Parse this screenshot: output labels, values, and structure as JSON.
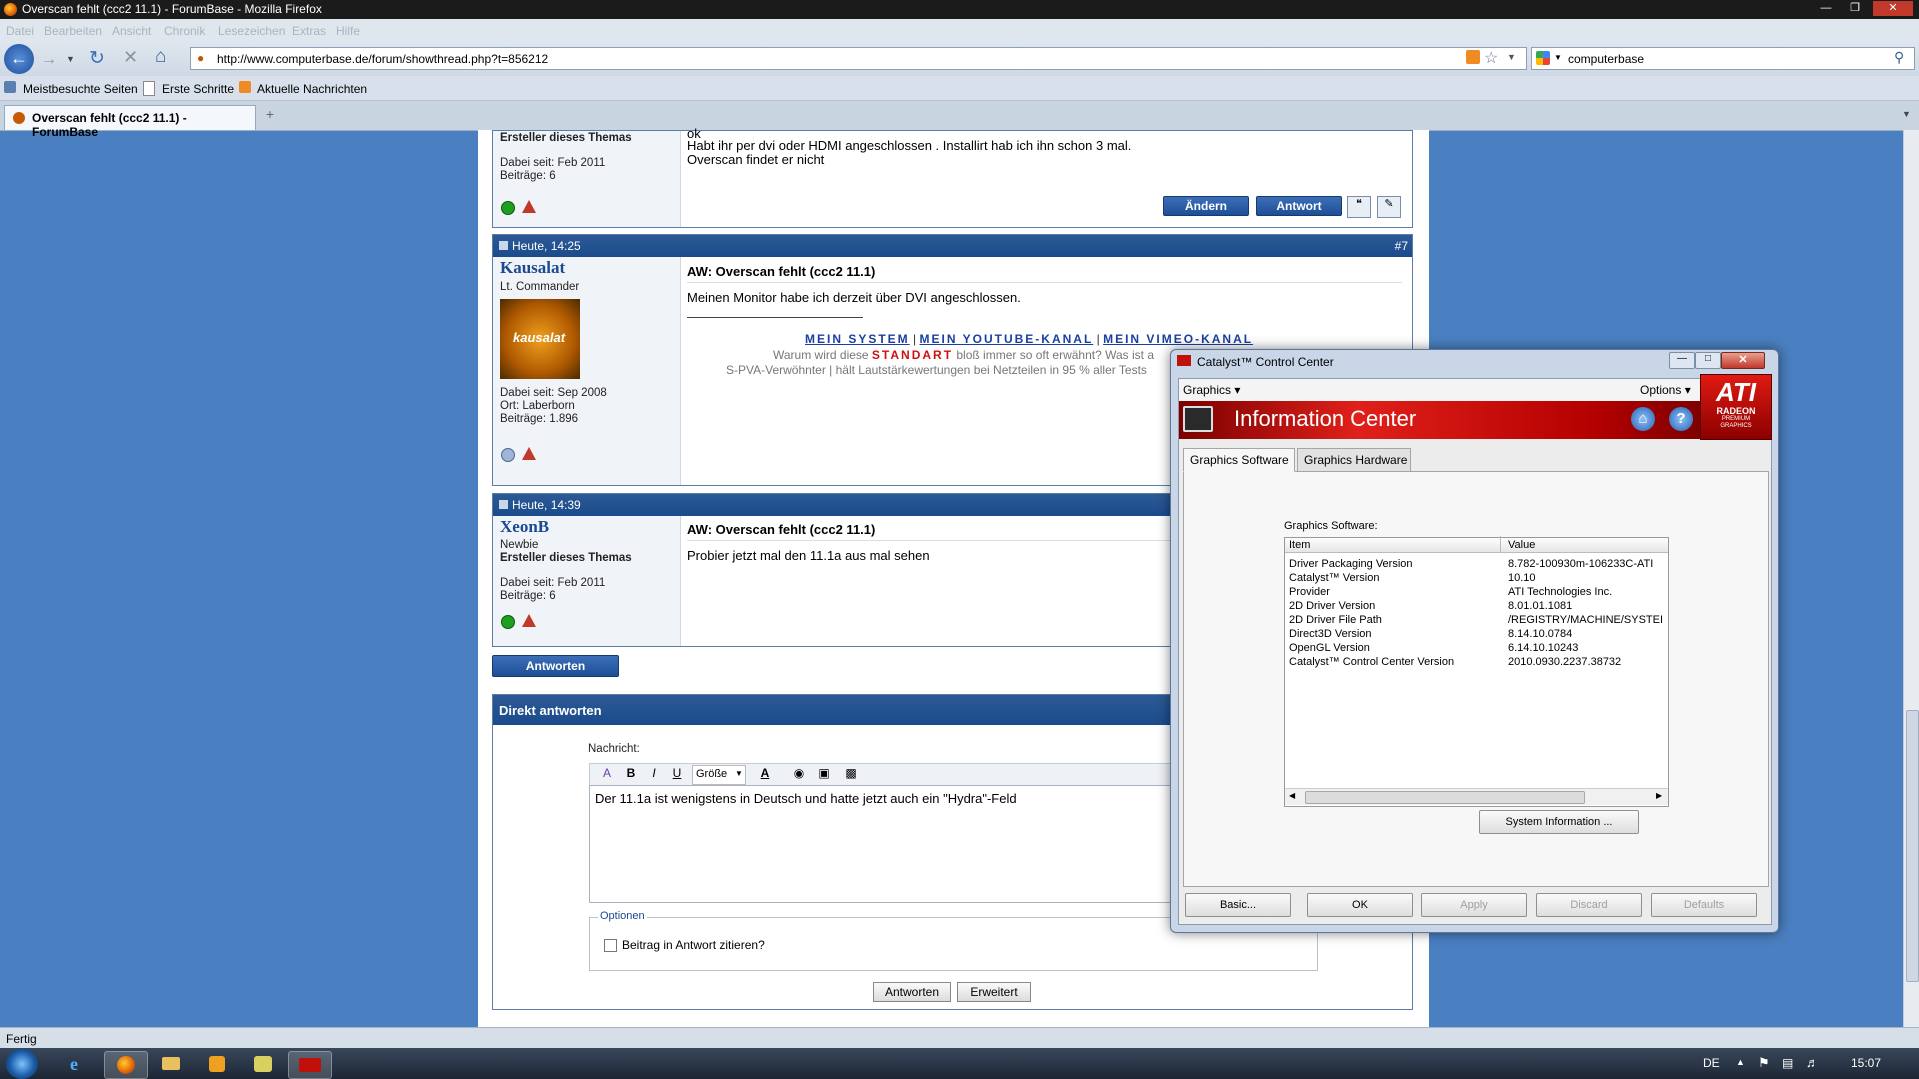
{
  "browser": {
    "window_title": "Overscan fehlt (ccc2 11.1) - ForumBase - Mozilla Firefox",
    "menu": [
      "Datei",
      "Bearbeiten",
      "Ansicht",
      "Chronik",
      "Lesezeichen",
      "Extras",
      "Hilfe"
    ],
    "url": "http://www.computerbase.de/forum/showthread.php?t=856212",
    "search_value": "computerbase",
    "bookmarks": [
      "Meistbesuchte Seiten",
      "Erste Schritte",
      "Aktuelle Nachrichten"
    ],
    "tab_title": "Overscan fehlt (ccc2 11.1) - ForumBase",
    "new_tab_symbol": "+",
    "status": "Fertig"
  },
  "post_top": {
    "user_role": "Ersteller dieses Themas",
    "joined": "Dabei seit: Feb 2011",
    "posts": "Beiträge: 6",
    "line0": "ok",
    "line1": "Habt ihr per dvi oder HDMI angeschlossen . Installirt hab ich ihn schon 3 mal.",
    "line2": "Overscan findet er nicht",
    "edit_label": "Ändern",
    "reply_label": "Antwort"
  },
  "post7": {
    "time": "Heute, 14:25",
    "number": "#7",
    "username": "Kausalat",
    "rank": "Lt. Commander",
    "avatar_text": "kausalat",
    "joined": "Dabei seit: Sep 2008",
    "location": "Ort: Laberborn",
    "posts": "Beiträge: 1.896",
    "subject": "AW: Overscan fehlt (ccc2 11.1)",
    "body": "Meinen Monitor habe ich derzeit über DVI angeschlossen.",
    "sig_link1": "MEIN SYSTEM",
    "sig_link2": "MEIN YOUTUBE-KANAL",
    "sig_link3": "MEIN VIMEO-KANAL",
    "sig_sep": "|",
    "sig_line2_pre": "Warum wird diese",
    "sig_line2_red": "STANDART",
    "sig_line2_post": "bloß immer so oft erwähnt? Was ist a",
    "sig_line3": "S-PVA-Verwöhnter  |  hält Lautstärkewertungen bei Netzteilen in 95 % aller Tests"
  },
  "post8": {
    "time": "Heute, 14:39",
    "username": "XeonB",
    "rank": "Newbie",
    "role": "Ersteller dieses Themas",
    "joined": "Dabei seit: Feb 2011",
    "posts": "Beiträge: 6",
    "subject": "AW: Overscan fehlt (ccc2 11.1)",
    "body": "Probier jetzt mal den 11.1a aus mal sehen"
  },
  "reply": {
    "antworten_button": "Antworten",
    "section_title": "Direkt antworten",
    "message_label": "Nachricht:",
    "size_label": "Größe",
    "message_value": "Der 11.1a ist wenigstens in Deutsch und hatte jetzt auch ein \"Hydra\"-Feld",
    "options_label": "Optionen",
    "quote_label": "Beitrag in Antwort zitieren?",
    "submit_label": "Antworten",
    "advanced_label": "Erweitert"
  },
  "taskbar": {
    "lang": "DE",
    "time": "15:07"
  },
  "ccc": {
    "title": "Catalyst™ Control Center",
    "menu_graphics": "Graphics",
    "menu_options": "Options",
    "banner_title": "Information Center",
    "ati_logo": "ATI",
    "ati_sub1": "RADEON",
    "ati_sub2": "PREMIUM",
    "ati_sub3": "GRAPHICS",
    "tab_software": "Graphics Software",
    "tab_hardware": "Graphics Hardware",
    "section_label": "Graphics Software:",
    "col_item": "Item",
    "col_value": "Value",
    "rows": [
      {
        "item": "Driver Packaging Version",
        "value": "8.782-100930m-106233C-ATI"
      },
      {
        "item": "Catalyst™ Version",
        "value": "10.10"
      },
      {
        "item": "Provider",
        "value": "ATI Technologies Inc."
      },
      {
        "item": "2D Driver Version",
        "value": "8.01.01.1081"
      },
      {
        "item": "2D Driver File Path",
        "value": "/REGISTRY/MACHINE/SYSTEI"
      },
      {
        "item": "Direct3D Version",
        "value": "8.14.10.0784"
      },
      {
        "item": "OpenGL Version",
        "value": "6.14.10.10243"
      },
      {
        "item": "Catalyst™ Control Center Version",
        "value": "2010.0930.2237.38732"
      }
    ],
    "system_info_button": "System Information ...",
    "btn_basic": "Basic...",
    "btn_ok": "OK",
    "btn_apply": "Apply",
    "btn_discard": "Discard",
    "btn_defaults": "Defaults"
  }
}
